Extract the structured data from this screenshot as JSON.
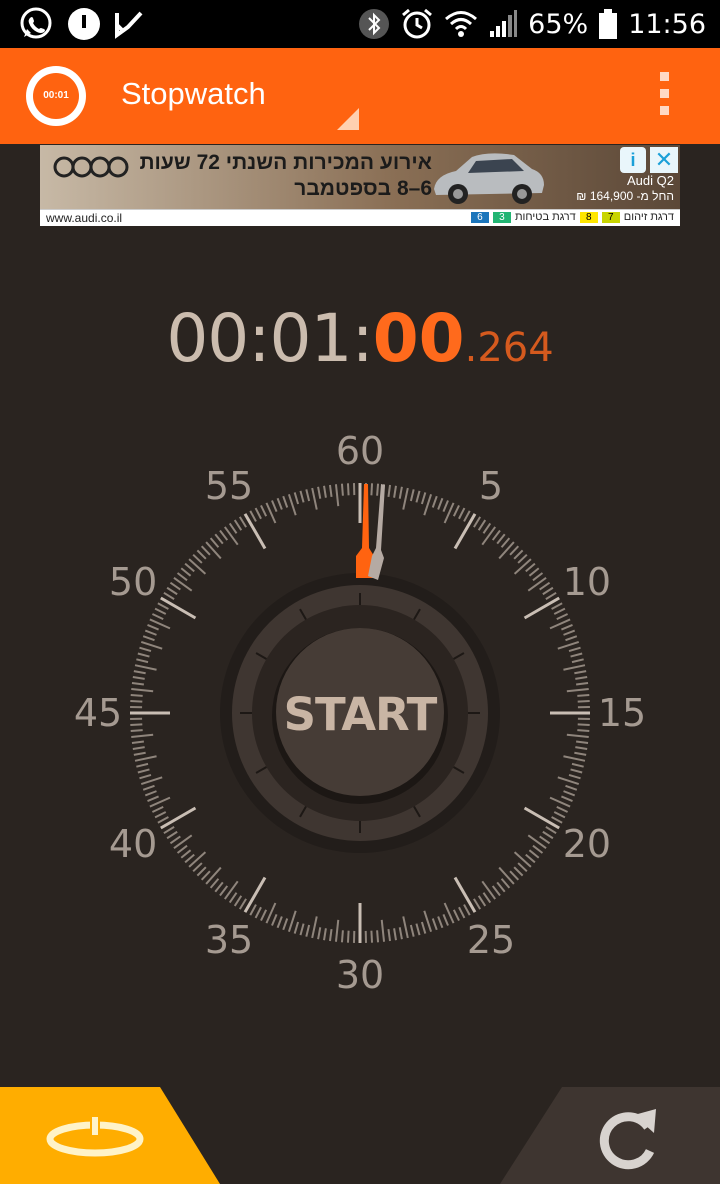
{
  "status_bar": {
    "battery": "65%",
    "time": "11:56",
    "left_icons": [
      "whatsapp-icon",
      "music-icon",
      "task-check-icon"
    ],
    "right_icons": [
      "bluetooth-icon",
      "alarm-icon",
      "wifi-icon",
      "signal-icon",
      "battery-icon"
    ]
  },
  "app_bar": {
    "logo_text": "00:01",
    "title": "Stopwatch"
  },
  "ad": {
    "headline": "אירוע המכירות השנתי 72 שעות",
    "subline": "6–8 בספטמבר",
    "model": "Audi Q2",
    "price": "החל מ- 164,900 ₪",
    "url": "www.audi.co.il",
    "rating_labels": [
      "דרגת זיהום",
      "7",
      "8",
      "דרגת בטיחות",
      "3",
      "6"
    ]
  },
  "timer": {
    "main": "00:01:",
    "seconds": "00",
    "millis": ".264"
  },
  "dial": {
    "labels": [
      "60",
      "5",
      "10",
      "15",
      "20",
      "25",
      "30",
      "35",
      "40",
      "45",
      "50",
      "55"
    ],
    "start_label": "START"
  },
  "colors": {
    "accent": "#ff6310",
    "background": "#2a2420",
    "lap_button": "#ffad00",
    "reset_button": "#3e3530"
  },
  "buttons": {
    "lap_icon": "lap-icon",
    "reset_icon": "reset-icon"
  }
}
